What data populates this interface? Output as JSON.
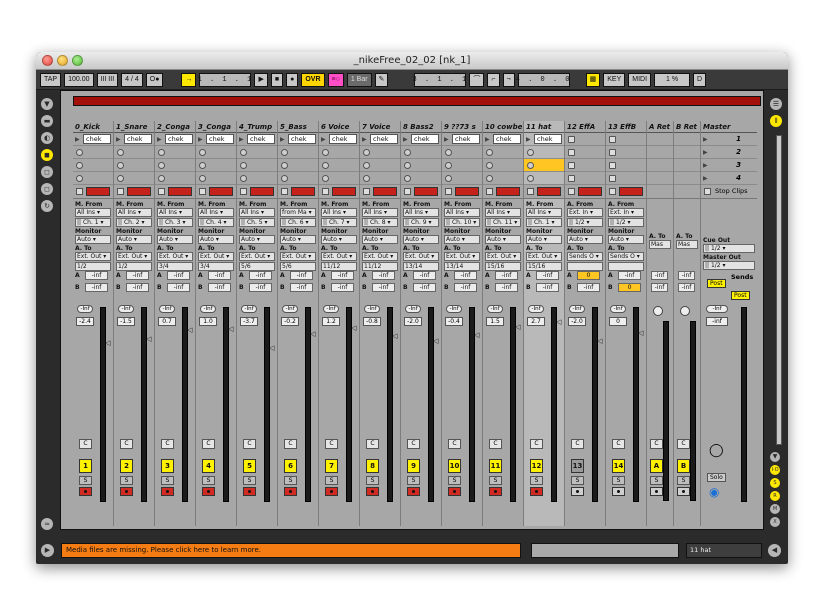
{
  "window": {
    "title": "_nikeFree_02_02  [nk_1]"
  },
  "transport": {
    "tap": "TAP",
    "tempo": "100.00",
    "nudge": "III III",
    "signature": "4 / 4",
    "metro": "O●",
    "follow": "→",
    "position": "1 .  1 .  1",
    "ovr": "OVR",
    "quant": "1 Bar",
    "loop_start": "3 .  1 .  1",
    "loop_len": "4 .  0 .  0",
    "key": "KEY",
    "midi": "MIDI",
    "cpu": "1 %",
    "disk": "D"
  },
  "tracks": [
    {
      "name": "0_Kick",
      "clip": "chek",
      "from": "M. From",
      "src": "All Ins",
      "ch": "Ch. 1",
      "vol": "-2.4",
      "num": "1",
      "sendA": "-inf",
      "sendB": "-inf",
      "chg": "1/2"
    },
    {
      "name": "1_Snare",
      "clip": "chek",
      "from": "M. From",
      "src": "All Ins",
      "ch": "Ch. 2",
      "vol": "-1.5",
      "num": "2",
      "sendA": "-inf",
      "sendB": "-inf",
      "chg": "1/2"
    },
    {
      "name": "2_Conga",
      "clip": "chek",
      "from": "M. From",
      "src": "All Ins",
      "ch": "Ch. 3",
      "vol": "0.7",
      "num": "3",
      "sendA": "-inf",
      "sendB": "-inf",
      "chg": "3/4"
    },
    {
      "name": "3_Conga",
      "clip": "chek",
      "from": "M. From",
      "src": "All Ins",
      "ch": "Ch. 4",
      "vol": "1.0",
      "num": "4",
      "sendA": "-inf",
      "sendB": "-inf",
      "chg": "3/4"
    },
    {
      "name": "4_Trump",
      "clip": "chek",
      "from": "M. From",
      "src": "All Ins",
      "ch": "Ch. 5",
      "vol": "-3.7",
      "num": "5",
      "sendA": "-inf",
      "sendB": "-inf",
      "chg": "5/6"
    },
    {
      "name": "5_Bass",
      "clip": "chek",
      "from": "M. From",
      "src": "from Ma",
      "ch": "Ch. 6",
      "vol": "-0.2",
      "num": "6",
      "sendA": "-inf",
      "sendB": "-inf",
      "chg": "5/6"
    },
    {
      "name": "6 Voice",
      "clip": "chek",
      "from": "M. From",
      "src": "All Ins",
      "ch": "Ch. 7",
      "vol": "1.2",
      "num": "7",
      "sendA": "-inf",
      "sendB": "-inf",
      "chg": "11/12"
    },
    {
      "name": "7 Voice",
      "clip": "chek",
      "from": "M. From",
      "src": "All Ins",
      "ch": "Ch. 8",
      "vol": "-0.8",
      "num": "8",
      "sendA": "-inf",
      "sendB": "-inf",
      "chg": "11/12"
    },
    {
      "name": "8 Bass2",
      "clip": "chek",
      "from": "M. From",
      "src": "All Ins",
      "ch": "Ch. 9",
      "vol": "-2.0",
      "num": "9",
      "sendA": "-inf",
      "sendB": "-inf",
      "chg": "13/14"
    },
    {
      "name": "9 ??73 s",
      "clip": "chek",
      "from": "M. From",
      "src": "All Ins",
      "ch": "Ch. 10",
      "vol": "-0.4",
      "num": "10",
      "sendA": "-inf",
      "sendB": "-inf",
      "chg": "13/14"
    },
    {
      "name": "10 cowbe",
      "clip": "chek",
      "from": "M. From",
      "src": "All Ins",
      "ch": "Ch. 11",
      "vol": "1.5",
      "num": "11",
      "sendA": "-inf",
      "sendB": "-inf",
      "chg": "15/16"
    },
    {
      "name": "11 hat",
      "clip": "chek",
      "from": "M. From",
      "src": "All Ins",
      "ch": "Ch. 1",
      "vol": "2.7",
      "num": "12",
      "sendA": "-inf",
      "sendB": "-inf",
      "chg": "15/16"
    },
    {
      "name": "12 EffA",
      "clip": "",
      "from": "A. From",
      "src": "Ext. In",
      "ch": "1/2",
      "vol": "-2.0",
      "num": "13",
      "sendA": "0",
      "sendB": "-inf",
      "chg": "Sends O"
    },
    {
      "name": "13 EffB",
      "clip": "",
      "from": "A. From",
      "src": "Ext. In",
      "ch": "1/2",
      "vol": "0",
      "num": "14",
      "sendA": "-inf",
      "sendB": "0",
      "chg": "Sends O"
    }
  ],
  "returns": [
    {
      "name": "A Ret",
      "num": "A",
      "to": "Mas"
    },
    {
      "name": "B Ret",
      "num": "B",
      "to": "Mas"
    }
  ],
  "master": {
    "name": "Master",
    "scenes": [
      "1",
      "2",
      "3",
      "4"
    ],
    "stop_clips": "Stop Clips",
    "cue_out": "Cue Out",
    "cue_val": "1/2",
    "master_out": "Master Out",
    "master_val": "1/2",
    "sends": "Sends",
    "post": "Post",
    "vol_a": "-inf",
    "vol_b": "-inf",
    "solo": "Solo"
  },
  "labels": {
    "monitor": "Monitor",
    "auto": "Auto",
    "ato": "A. To",
    "extout": "Ext. Out",
    "a": "A",
    "b": "B",
    "c": "C",
    "s": "S",
    "inf": "-Inf"
  },
  "status": {
    "message": "Media files are missing. Please click here to learn more.",
    "right": "11 hat"
  }
}
